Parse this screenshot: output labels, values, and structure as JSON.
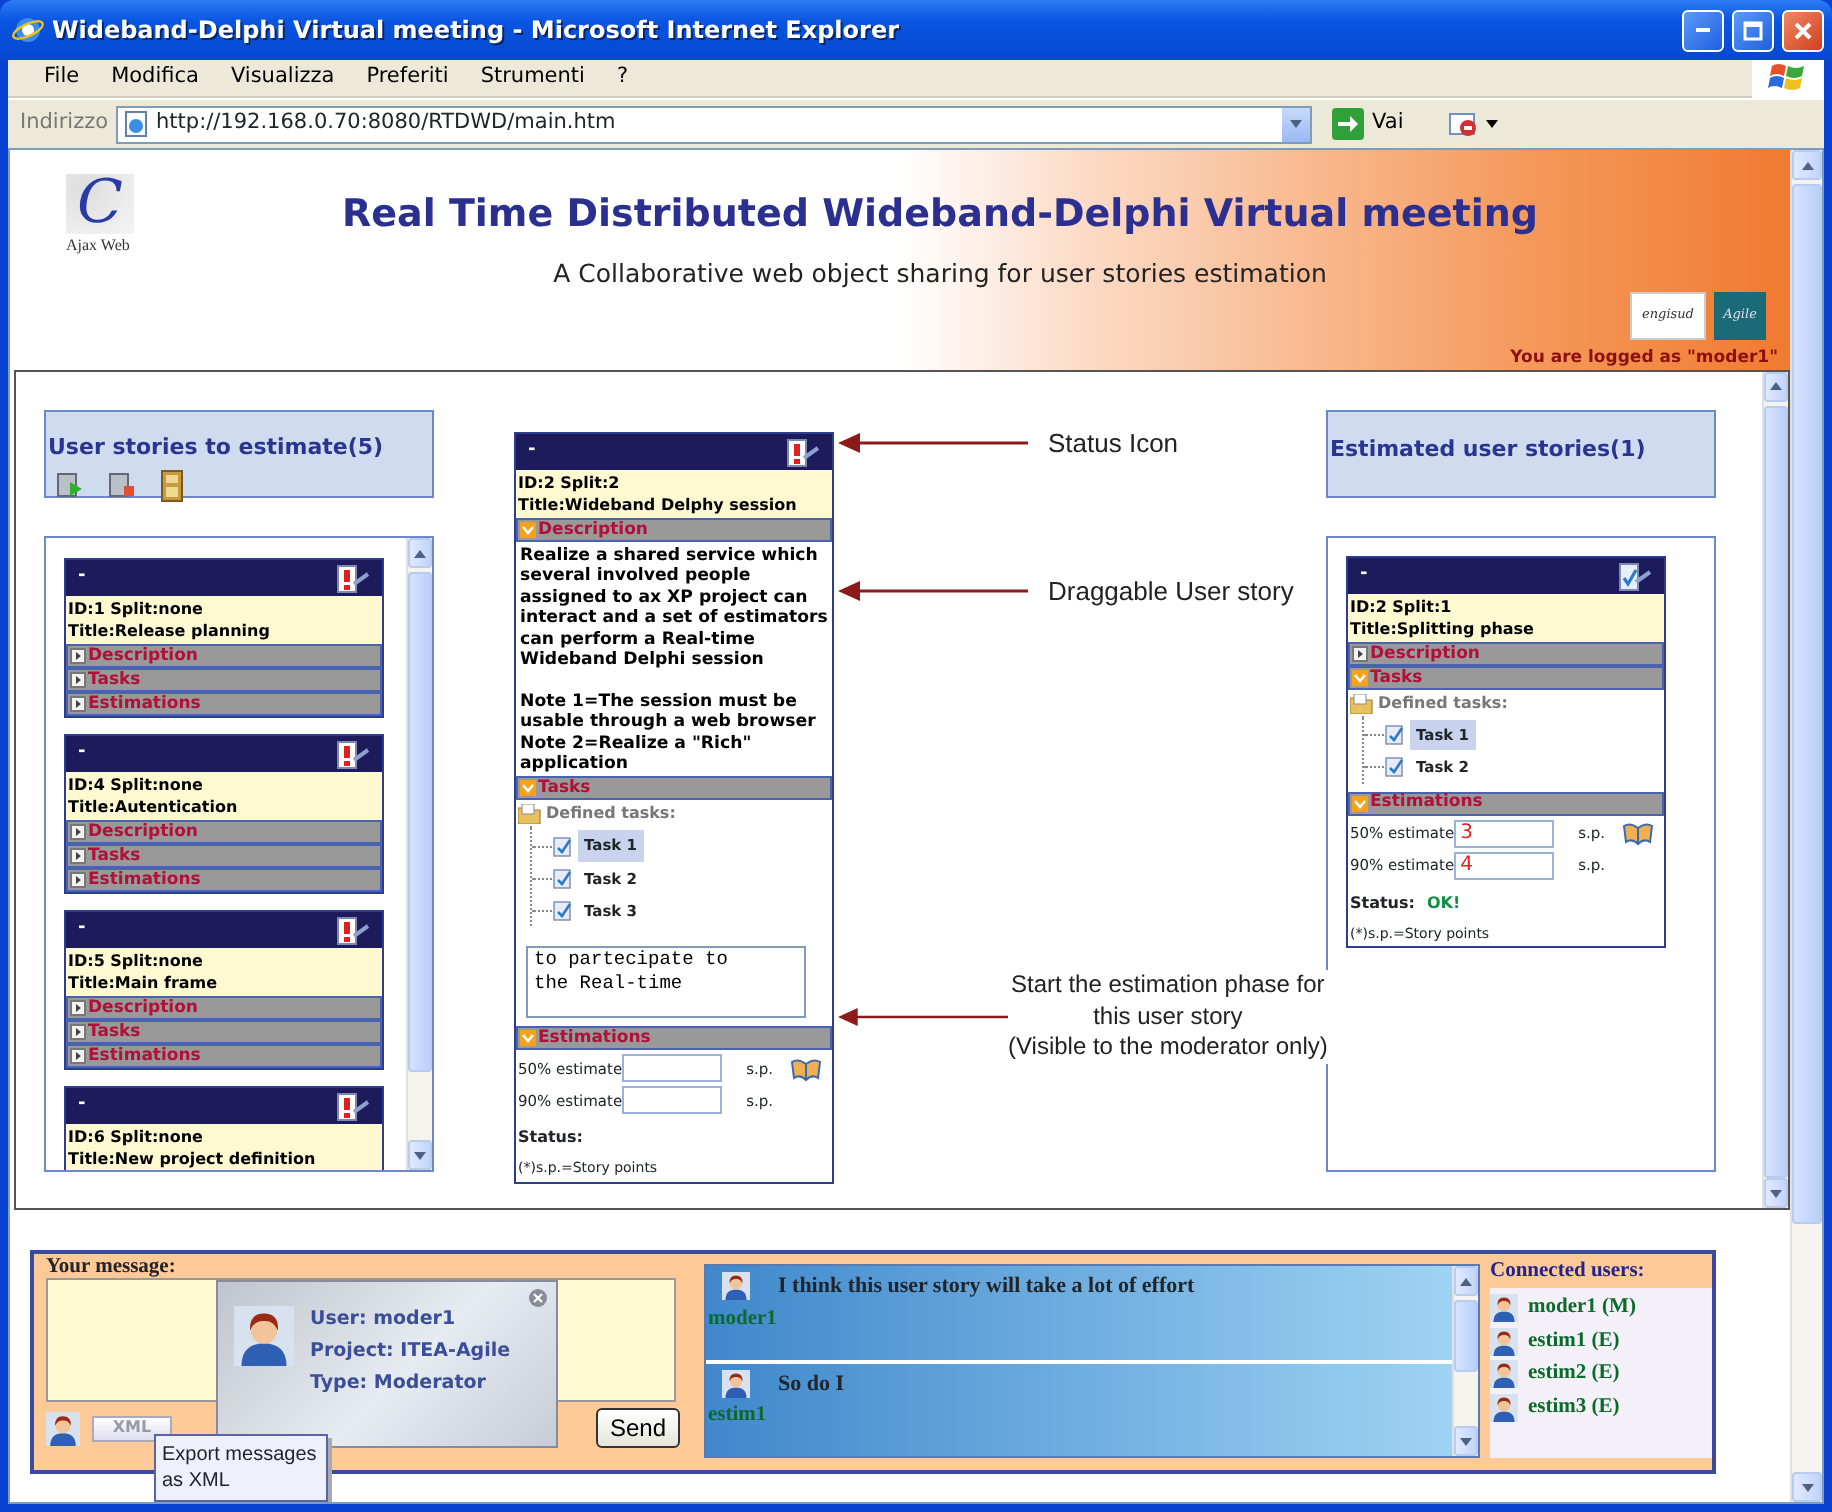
{
  "window": {
    "title": "Wideband-Delphi Virtual meeting - Microsoft Internet Explorer"
  },
  "menu": [
    {
      "label": "File"
    },
    {
      "label": "Modifica"
    },
    {
      "label": "Visualizza"
    },
    {
      "label": "Preferiti"
    },
    {
      "label": "Strumenti"
    },
    {
      "label": "?"
    }
  ],
  "address_bar": {
    "label": "Indirizzo",
    "url": "http://192.168.0.70:8080/RTDWD/main.htm",
    "go_label": "Vai"
  },
  "banner": {
    "logo_mark": "C",
    "logo_caption": "Ajax Web",
    "title": "Real Time Distributed Wideband-Delphi Virtual meeting",
    "subtitle": "A Collaborative web object sharing for user stories estimation",
    "partner_logos": [
      {
        "text": "engisud"
      },
      {
        "text": "Agile"
      }
    ],
    "logged_in": "You are logged as \"moder1\""
  },
  "to_estimate": {
    "heading": "User stories to estimate(5)",
    "stories": [
      {
        "collapse": "-",
        "estimated": false,
        "id_line": "ID:1  Split:none",
        "title": "Title:Release planning",
        "sections": [
          {
            "label": "Description",
            "expanded": false
          },
          {
            "label": "Tasks",
            "expanded": false
          },
          {
            "label": "Estimations",
            "expanded": false
          }
        ]
      },
      {
        "collapse": "-",
        "estimated": false,
        "id_line": "ID:4  Split:none",
        "title": "Title:Autentication",
        "sections": [
          {
            "label": "Description",
            "expanded": false
          },
          {
            "label": "Tasks",
            "expanded": false
          },
          {
            "label": "Estimations",
            "expanded": false
          }
        ]
      },
      {
        "collapse": "-",
        "estimated": false,
        "id_line": "ID:5  Split:none",
        "title": "Title:Main frame",
        "sections": [
          {
            "label": "Description",
            "expanded": false
          },
          {
            "label": "Tasks",
            "expanded": false
          },
          {
            "label": "Estimations",
            "expanded": false
          }
        ]
      },
      {
        "collapse": "-",
        "estimated": false,
        "id_line": "ID:6  Split:none",
        "title": "Title:New project definition"
      }
    ]
  },
  "current_story": {
    "collapse": "-",
    "estimated": false,
    "id_line": "ID:2  Split:2",
    "title": "Title:Wideband Delphy session",
    "sections": [
      {
        "kind": "description",
        "label": "Description",
        "expanded": true,
        "text": "Realize a shared service which several involved people assigned to ax XP project can interact and a set of estimators can perform a Real-time Wideband Delphi session\n\nNote 1=The session must be usable through a web browser\nNote 2=Realize a \"Rich\" application"
      },
      {
        "kind": "tasks",
        "label": "Tasks",
        "expanded": true,
        "tree_label": "Defined tasks:",
        "tasks": [
          {
            "label": "Task 1",
            "selected": true
          },
          {
            "label": "Task 2",
            "selected": false
          },
          {
            "label": "Task 3",
            "selected": false
          }
        ],
        "notes": "to partecipate to\nthe Real-time"
      },
      {
        "kind": "estimations",
        "label": "Estimations",
        "expanded": true,
        "rows": [
          {
            "label": "50% estimate",
            "unit": "s.p."
          },
          {
            "label": "90% estimate",
            "unit": "s.p."
          }
        ],
        "status_label": "Status:",
        "footnote": "(*)s.p.=Story points"
      }
    ]
  },
  "annotations": [
    {
      "text": "Status Icon"
    },
    {
      "text": "Draggable User story"
    },
    {
      "text": "Start the estimation phase for\nthis user story\n(Visible to the moderator only)"
    }
  ],
  "estimated": {
    "heading": "Estimated user stories(1)",
    "stories": [
      {
        "collapse": "-",
        "estimated": true,
        "id_line": "ID:2  Split:1",
        "title": "Title:Splitting phase",
        "sections": [
          {
            "label": "Description",
            "expanded": false
          },
          {
            "kind": "tasks",
            "label": "Tasks",
            "expanded": true,
            "tree_label": "Defined tasks:",
            "tasks": [
              {
                "label": "Task 1",
                "selected": true
              },
              {
                "label": "Task 2",
                "selected": false
              }
            ]
          },
          {
            "kind": "estimations",
            "label": "Estimations",
            "expanded": true,
            "rows": [
              {
                "label": "50% estimate",
                "value": "3",
                "unit": "s.p."
              },
              {
                "label": "90% estimate",
                "value": "4",
                "unit": "s.p."
              }
            ],
            "status_label": "Status:",
            "status_value": "OK!",
            "footnote": "(*)s.p.=Story points"
          }
        ]
      }
    ]
  },
  "chat": {
    "label": "Your message:",
    "user_card": {
      "user": "User: moder1",
      "project": "Project: ITEA-Agile",
      "type": "Type: Moderator"
    },
    "xml_badge": "XML",
    "send": "Send",
    "tooltip": "Export messages as XML",
    "messages": [
      {
        "text": "I think this user story will take a lot of effort",
        "user": "moder1"
      },
      {
        "text": "So do I",
        "user": "estim1"
      }
    ],
    "users_heading": "Connected users:",
    "users": [
      {
        "label": "moder1 (M)"
      },
      {
        "label": "estim1 (E)"
      },
      {
        "label": "estim2 (E)"
      },
      {
        "label": "estim3 (E)"
      }
    ]
  }
}
